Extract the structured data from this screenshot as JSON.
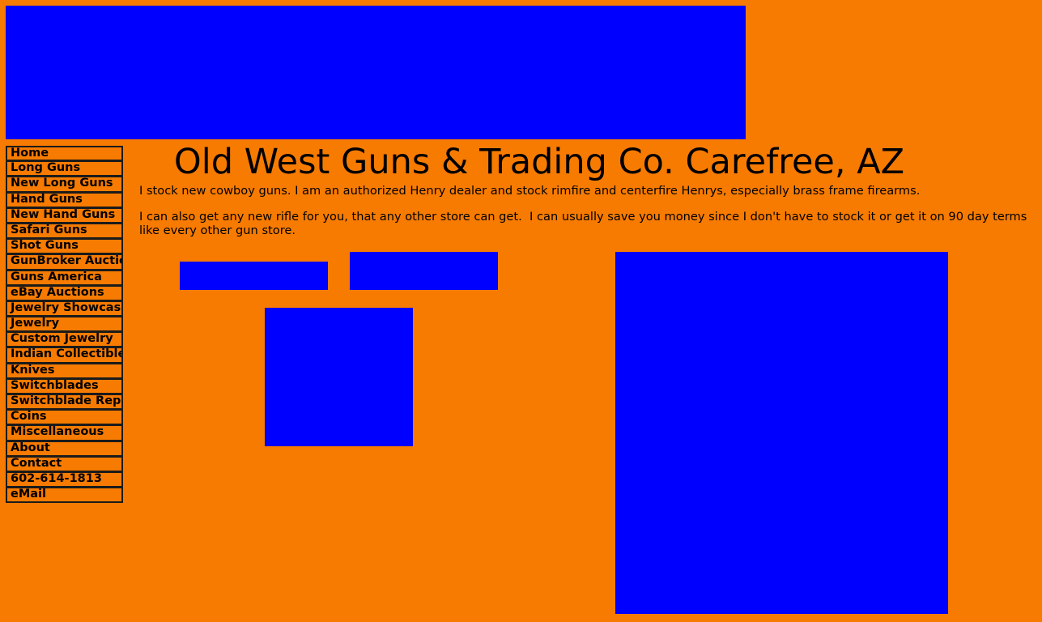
{
  "nav": {
    "items": [
      {
        "label": "Home"
      },
      {
        "label": "Long Guns"
      },
      {
        "label": "New Long Guns"
      },
      {
        "label": "Hand Guns"
      },
      {
        "label": "New Hand Guns"
      },
      {
        "label": "Safari Guns"
      },
      {
        "label": "Shot Guns"
      },
      {
        "label": "GunBroker Auctions"
      },
      {
        "label": "Guns America"
      },
      {
        "label": "eBay Auctions"
      },
      {
        "label": "Jewelry Showcase"
      },
      {
        "label": "Jewelry"
      },
      {
        "label": "Custom Jewelry"
      },
      {
        "label": "Indian Collectibles"
      },
      {
        "label": "Knives"
      },
      {
        "label": "Switchblades"
      },
      {
        "label": "Switchblade Repair"
      },
      {
        "label": "Coins"
      },
      {
        "label": "Miscellaneous"
      },
      {
        "label": "About"
      },
      {
        "label": "Contact"
      },
      {
        "label": "602-614-1813"
      },
      {
        "label": "eMail"
      }
    ]
  },
  "main": {
    "title": "Old West Guns & Trading Co. Carefree, AZ",
    "paragraph_1": "I stock new cowboy guns. I am an authorized Henry dealer and stock rimfire and centerfire Henrys, especially brass frame firearms.",
    "paragraph_2": "I can also get any new rifle for you, that any other store can get.  I can usually save you money since I don't have to stock it or get it on 90 day terms like every other gun store."
  },
  "colors": {
    "background": "#f77b00",
    "placeholder_image": "#0000ff",
    "nav_border": "#1b1b1b",
    "text": "#000000"
  }
}
